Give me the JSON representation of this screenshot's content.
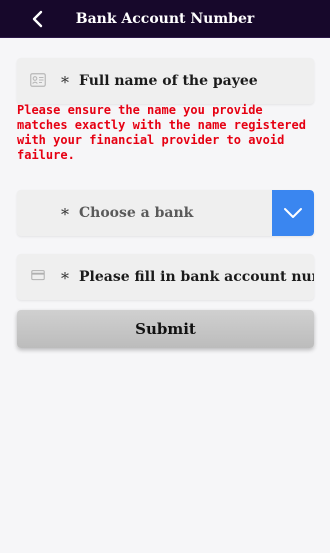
{
  "header": {
    "title": "Bank Account Number",
    "back_icon": "chevron-left-icon"
  },
  "form": {
    "payee_name": {
      "required_mark": "*",
      "placeholder": "Full name of the payee",
      "icon": "id-card-icon"
    },
    "warning": "Please ensure the name you provide matches exactly with the name registered with your financial provider to avoid failure.",
    "bank_select": {
      "required_mark": "*",
      "placeholder": "Choose a bank",
      "dropdown_icon": "chevron-down-icon"
    },
    "account_number": {
      "required_mark": "*",
      "placeholder": "Please fill in bank account number",
      "icon": "credit-card-icon"
    },
    "submit_label": "Submit"
  },
  "colors": {
    "header_bg": "#17082b",
    "warning": "#e60012",
    "dropdown_accent": "#3a86f0",
    "submit_bg": "#c8c8c8"
  }
}
